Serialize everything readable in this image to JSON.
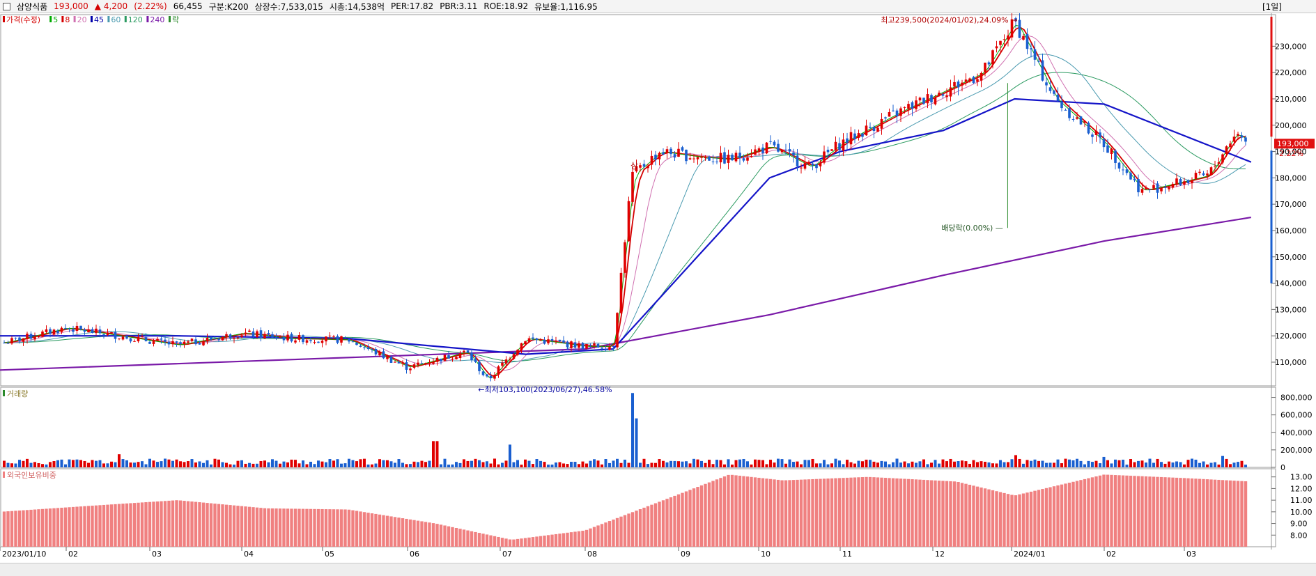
{
  "header": {
    "name": "삼양식품",
    "price": "193,000",
    "change": "▲  4,200",
    "change_pct": "(2.22%)",
    "volume": "66,455",
    "market": "구분:K200",
    "shares": "상장수:7,533,015",
    "mktcap": "시총:14,538억",
    "per": "PER:17.82",
    "pbr": "PBR:3.11",
    "roe": "ROE:18.92",
    "float": "유보율:1,116.95",
    "period": "[1일]"
  },
  "price_legend": [
    {
      "label": "가격(수정)",
      "color": "#d40000"
    },
    {
      "label": "5",
      "color": "#00aa00"
    },
    {
      "label": "8",
      "color": "#d40000"
    },
    {
      "label": "20",
      "color": "#d070b0"
    },
    {
      "label": "45",
      "color": "#0000aa"
    },
    {
      "label": "60",
      "color": "#4a9ab0"
    },
    {
      "label": "120",
      "color": "#2a9a60"
    },
    {
      "label": "240",
      "color": "#7a1aa8"
    },
    {
      "label": "락",
      "color": "#2a8a2a"
    }
  ],
  "annotations": {
    "high": "최고239,500(2024/01/02),24.09%",
    "low": "최저103,100(2023/06/27),46.58%",
    "dividend": "배당락(0.00%)",
    "limit_up": "상"
  },
  "last_price_tag": {
    "price": "193,000",
    "pct": "2.22%"
  },
  "volume_title": "거래량",
  "foreign_title": "외국인보유비중",
  "colors": {
    "up": "#e00000",
    "down": "#1a5fd0",
    "ma45": "#1414c8",
    "ma240": "#7a1aa8",
    "foreign": "#f08080"
  },
  "chart_data": [
    {
      "type": "line",
      "subtype": "candlestick",
      "ylim": [
        101000,
        242000
      ],
      "y_ticks": [
        "230,000",
        "220,000",
        "210,000",
        "200,000",
        "190,000",
        "180,000",
        "170,000",
        "160,000",
        "150,000",
        "140,000",
        "130,000",
        "120,000",
        "110,000"
      ],
      "x_ticks": [
        "2023/01/10",
        "02",
        "03",
        "04",
        "05",
        "06",
        "07",
        "08",
        "09",
        "10",
        "11",
        "12",
        "2024/01",
        "02",
        "03"
      ],
      "series": [
        {
          "name": "가격(수정)",
          "x": [
            "2023/01/10",
            "01/31",
            "02/20",
            "03/10",
            "03/31",
            "04/20",
            "05/10",
            "05/31",
            "06/20",
            "06/27",
            "07/10",
            "07/31",
            "08/10",
            "08/16",
            "08/25",
            "09/08",
            "09/20",
            "10/05",
            "10/20",
            "11/01",
            "11/20",
            "12/05",
            "12/20",
            "2024/01/02",
            "01/15",
            "01/31",
            "02/15",
            "02/28",
            "03/10",
            "03/20",
            "03/26"
          ],
          "values": [
            117000,
            123000,
            120000,
            116500,
            121000,
            119000,
            118500,
            108000,
            114000,
            103100,
            119000,
            116000,
            116000,
            181000,
            190000,
            188000,
            187000,
            192000,
            184000,
            193000,
            205000,
            213000,
            220000,
            239500,
            210000,
            193000,
            175000,
            178000,
            181000,
            197000,
            193000
          ]
        },
        {
          "name": "45",
          "x": [
            "2023/01/10",
            "03/10",
            "05/10",
            "07/10",
            "08/10",
            "09/08",
            "10/05",
            "11/01",
            "12/05",
            "2024/01/02",
            "01/31",
            "03/26"
          ],
          "values": [
            120000,
            120000,
            119000,
            113000,
            115000,
            150000,
            180000,
            190000,
            198000,
            210000,
            208000,
            186000
          ]
        },
        {
          "name": "240",
          "x": [
            "2023/01/10",
            "04/20",
            "07/31",
            "10/05",
            "12/05",
            "2024/01/31",
            "03/26"
          ],
          "values": [
            107000,
            111000,
            115000,
            128000,
            143000,
            156000,
            165000
          ]
        }
      ]
    },
    {
      "type": "bar",
      "title": "거래량",
      "ylim": [
        0,
        900000
      ],
      "y_ticks": [
        "800,000",
        "600,000",
        "400,000",
        "200,000",
        "0"
      ],
      "x": [
        "2023/01/10",
        "02/20",
        "06/10",
        "07/05",
        "08/16",
        "08/18",
        "12/30",
        "2024/01/02",
        "02/01",
        "03/15"
      ],
      "values": [
        40000,
        150000,
        300000,
        260000,
        850000,
        560000,
        60000,
        140000,
        120000,
        130000
      ]
    },
    {
      "type": "bar",
      "title": "외국인보유비중",
      "ylim": [
        7.0,
        13.7
      ],
      "y_ticks": [
        "13.00",
        "12.00",
        "11.00",
        "10.00",
        "9.00",
        "8.00"
      ],
      "x": [
        "2023/01/10",
        "02/15",
        "03/10",
        "04/10",
        "05/10",
        "06/10",
        "07/05",
        "07/31",
        "08/31",
        "09/20",
        "10/10",
        "11/10",
        "12/10",
        "2024/01/02",
        "02/01",
        "03/01",
        "03/26"
      ],
      "values": [
        10.0,
        10.6,
        11.0,
        10.3,
        10.2,
        9.0,
        7.6,
        8.4,
        11.5,
        13.2,
        12.7,
        13.0,
        12.6,
        11.4,
        13.2,
        12.9,
        12.6
      ]
    }
  ]
}
